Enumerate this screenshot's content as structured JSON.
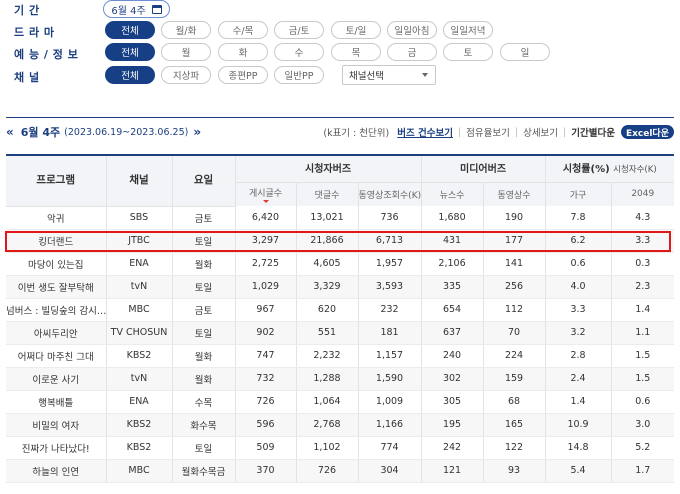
{
  "filters": {
    "period_label": "기 간",
    "period_value": "6월 4주",
    "drama_label": "드 라 마",
    "drama_options": [
      "전체",
      "월/화",
      "수/목",
      "금/토",
      "토/일",
      "일일아침",
      "일일저녁"
    ],
    "variety_label": "예 능 / 정 보",
    "variety_options": [
      "전체",
      "월",
      "화",
      "수",
      "목",
      "금",
      "토",
      "일"
    ],
    "channel_label": "채 널",
    "channel_options": [
      "전체",
      "지상파",
      "종편PP",
      "일반PP"
    ],
    "channel_select": "채널선택"
  },
  "header": {
    "week": "6월 4주",
    "range": "(2023.06.19~2023.06.25)",
    "unit": "(k표기 : 천단위)",
    "views": [
      "버즈 건수보기",
      "점유율보기",
      "상세보기",
      "기간별다운"
    ],
    "excel": "Excel다운"
  },
  "table": {
    "col_program": "프로그램",
    "col_channel": "채널",
    "col_day": "요일",
    "group_viewer_buzz": "시청자버즈",
    "group_media_buzz": "미디어버즈",
    "group_rating": "시청률(%)",
    "group_rating_sub": "시청자수(K)",
    "sub_headers": [
      "게시글수",
      "댓글수",
      "동영상조회수(K)",
      "뉴스수",
      "동영상수",
      "가구",
      "2049"
    ],
    "rows": [
      {
        "program": "악귀",
        "channel": "SBS",
        "day": "금토",
        "posts": "6,420",
        "comments": "13,021",
        "video_views": "736",
        "news": "1,680",
        "videos": "190",
        "household": "7.8",
        "r2049": "4.3"
      },
      {
        "program": "킹더랜드",
        "channel": "JTBC",
        "day": "토일",
        "posts": "3,297",
        "comments": "21,866",
        "video_views": "6,713",
        "news": "431",
        "videos": "177",
        "household": "6.2",
        "r2049": "3.3"
      },
      {
        "program": "마당이 있는집",
        "channel": "ENA",
        "day": "월화",
        "posts": "2,725",
        "comments": "4,605",
        "video_views": "1,957",
        "news": "2,106",
        "videos": "141",
        "household": "0.6",
        "r2049": "0.3"
      },
      {
        "program": "이번 생도 잘부탁해",
        "channel": "tvN",
        "day": "토일",
        "posts": "1,029",
        "comments": "3,329",
        "video_views": "3,593",
        "news": "335",
        "videos": "256",
        "household": "4.0",
        "r2049": "2.3"
      },
      {
        "program": "넘버스 : 빌딩숲의 감시…",
        "channel": "MBC",
        "day": "금토",
        "posts": "967",
        "comments": "620",
        "video_views": "232",
        "news": "654",
        "videos": "112",
        "household": "3.3",
        "r2049": "1.4"
      },
      {
        "program": "아씨두리안",
        "channel": "TV CHOSUN",
        "day": "토일",
        "posts": "902",
        "comments": "551",
        "video_views": "181",
        "news": "637",
        "videos": "70",
        "household": "3.2",
        "r2049": "1.1"
      },
      {
        "program": "어쩌다 마주친 그대",
        "channel": "KBS2",
        "day": "월화",
        "posts": "747",
        "comments": "2,232",
        "video_views": "1,157",
        "news": "240",
        "videos": "224",
        "household": "2.8",
        "r2049": "1.5"
      },
      {
        "program": "이로운 사기",
        "channel": "tvN",
        "day": "월화",
        "posts": "732",
        "comments": "1,288",
        "video_views": "1,590",
        "news": "302",
        "videos": "159",
        "household": "2.4",
        "r2049": "1.5"
      },
      {
        "program": "행복배틀",
        "channel": "ENA",
        "day": "수목",
        "posts": "726",
        "comments": "1,064",
        "video_views": "1,009",
        "news": "305",
        "videos": "68",
        "household": "1.4",
        "r2049": "0.6"
      },
      {
        "program": "비밀의 여자",
        "channel": "KBS2",
        "day": "화수목",
        "posts": "596",
        "comments": "2,768",
        "video_views": "1,166",
        "news": "195",
        "videos": "165",
        "household": "10.9",
        "r2049": "3.0"
      },
      {
        "program": "진짜가 나타났다!",
        "channel": "KBS2",
        "day": "토일",
        "posts": "509",
        "comments": "1,102",
        "video_views": "774",
        "news": "242",
        "videos": "122",
        "household": "14.8",
        "r2049": "5.2"
      },
      {
        "program": "하늘의 인연",
        "channel": "MBC",
        "day": "월화수목금",
        "posts": "370",
        "comments": "726",
        "video_views": "304",
        "news": "121",
        "videos": "93",
        "household": "5.4",
        "r2049": "1.7"
      }
    ]
  }
}
